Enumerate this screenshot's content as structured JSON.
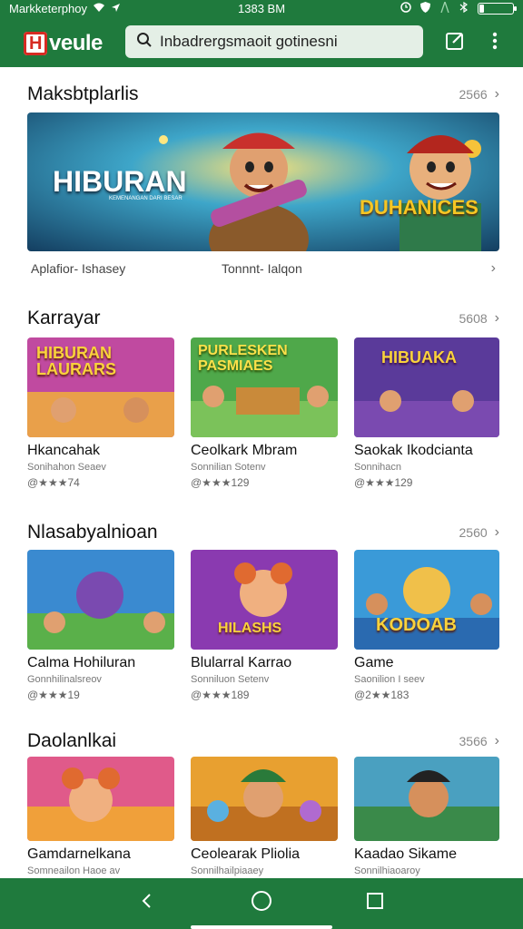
{
  "status_bar": {
    "carrier": "Markketerphoy",
    "time": "1383 BM",
    "battery_level": 0.12,
    "icons": [
      "wifi-icon",
      "location-icon",
      "alarm-icon",
      "shield-icon",
      "bluetooth-icon",
      "battery-icon"
    ]
  },
  "app_bar": {
    "logo_mark": "H",
    "logo_text": "veule",
    "search_placeholder": "Inbadrergsmaoit gotinesni",
    "search_icon": "search-icon",
    "edit_icon": "edit-icon",
    "menu_icon": "more-vert-icon",
    "color": "#1f7a3d"
  },
  "featured": {
    "title": "Maksbtplarlis",
    "more": "2566",
    "banner_text": "HIBURAN",
    "banner_subtext": "KEMENANGAN DARI BESAR",
    "banner_badge": "DUHANICES",
    "meta_left": "Aplafior- Ishasey",
    "meta_right": "Tonnnt- Ialqon"
  },
  "sections": [
    {
      "title": "Karrayar",
      "more": "5608",
      "cards": [
        {
          "title": "Hkancahak",
          "sub": "Sonihahon Seaev",
          "rating": "@★★★74",
          "thumb_text": "HIBURAN LAURARS"
        },
        {
          "title": "Ceolkark Mbram",
          "sub": "Sonnilian Sotenv",
          "rating": "@★★★129",
          "thumb_text": "PURLESKEN PASMIAES"
        },
        {
          "title": "Saokak Ikodcianta",
          "sub": "Sonnihacn",
          "rating": "@★★★129",
          "thumb_text": "HIBUAKA"
        }
      ]
    },
    {
      "title": "Nlasabyalnioan",
      "more": "2560",
      "cards": [
        {
          "title": "Calma Hohiluran",
          "sub": "Gonnhilinalsreov",
          "rating": "@★★★19",
          "thumb_text": ""
        },
        {
          "title": "Blularral Karrao",
          "sub": "Sonniluon Setenv",
          "rating": "@★★★189",
          "thumb_text": "HILASHS"
        },
        {
          "title": "Game",
          "sub": "Saonilion I seev",
          "rating": "@2★★183",
          "thumb_text": "KODOAB"
        }
      ]
    },
    {
      "title": "Daolanlkai",
      "more": "3566",
      "cards": [
        {
          "title": "Gamdarnelkana",
          "sub": "Somneailon Haoe av",
          "rating": "",
          "thumb_text": ""
        },
        {
          "title": "Ceolearak Pliolia",
          "sub": "Sonnilhailpiaaey",
          "rating": "",
          "thumb_text": ""
        },
        {
          "title": "Kaadao Sikame",
          "sub": "Sonnilhiaoaroy",
          "rating": "",
          "thumb_text": ""
        }
      ]
    }
  ],
  "nav_bar": {
    "back_icon": "back-icon",
    "home_icon": "home-icon",
    "recents_icon": "recents-icon"
  }
}
